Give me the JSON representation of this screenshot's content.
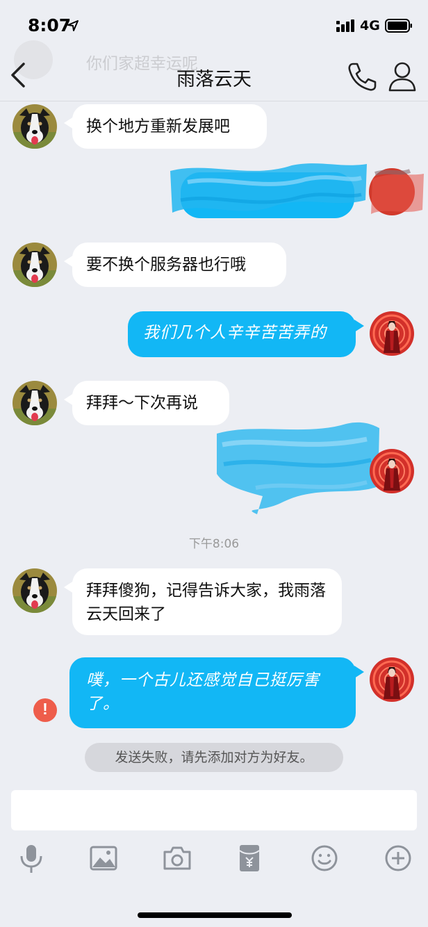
{
  "status_bar": {
    "time": "8:07",
    "network": "4G"
  },
  "background_preview": {
    "text": "你们家超幸运呢"
  },
  "nav": {
    "title": "雨落云天"
  },
  "messages": [
    {
      "side": "in",
      "text": "换个地方重新发展吧"
    },
    {
      "side": "out",
      "text": "",
      "redacted": true
    },
    {
      "side": "in",
      "text": "要不换个服务器也行哦"
    },
    {
      "side": "out",
      "text": "我们几个人辛辛苦苦弄的"
    },
    {
      "side": "in",
      "text": "拜拜～下次再说"
    },
    {
      "side": "out",
      "text": "",
      "redacted": true
    },
    {
      "side": "in",
      "text": "拜拜傻狗，记得告诉大家，我雨落云天回来了"
    },
    {
      "side": "out",
      "text": "噗，一个古儿还感觉自己挺厉害了。",
      "failed": true
    }
  ],
  "timestamp": "下午8:06",
  "error_badge": "!",
  "failure_notice": "发送失败，请先添加对方为好友。",
  "input": {
    "value": ""
  },
  "toolbar": {
    "icons": [
      "microphone-icon",
      "image-icon",
      "camera-icon",
      "red-packet-icon",
      "emoji-icon",
      "plus-icon"
    ]
  },
  "colors": {
    "bubble_out": "#12b7f5",
    "bubble_in": "#ffffff",
    "background": "#eceef3",
    "error": "#ee5d4b"
  }
}
